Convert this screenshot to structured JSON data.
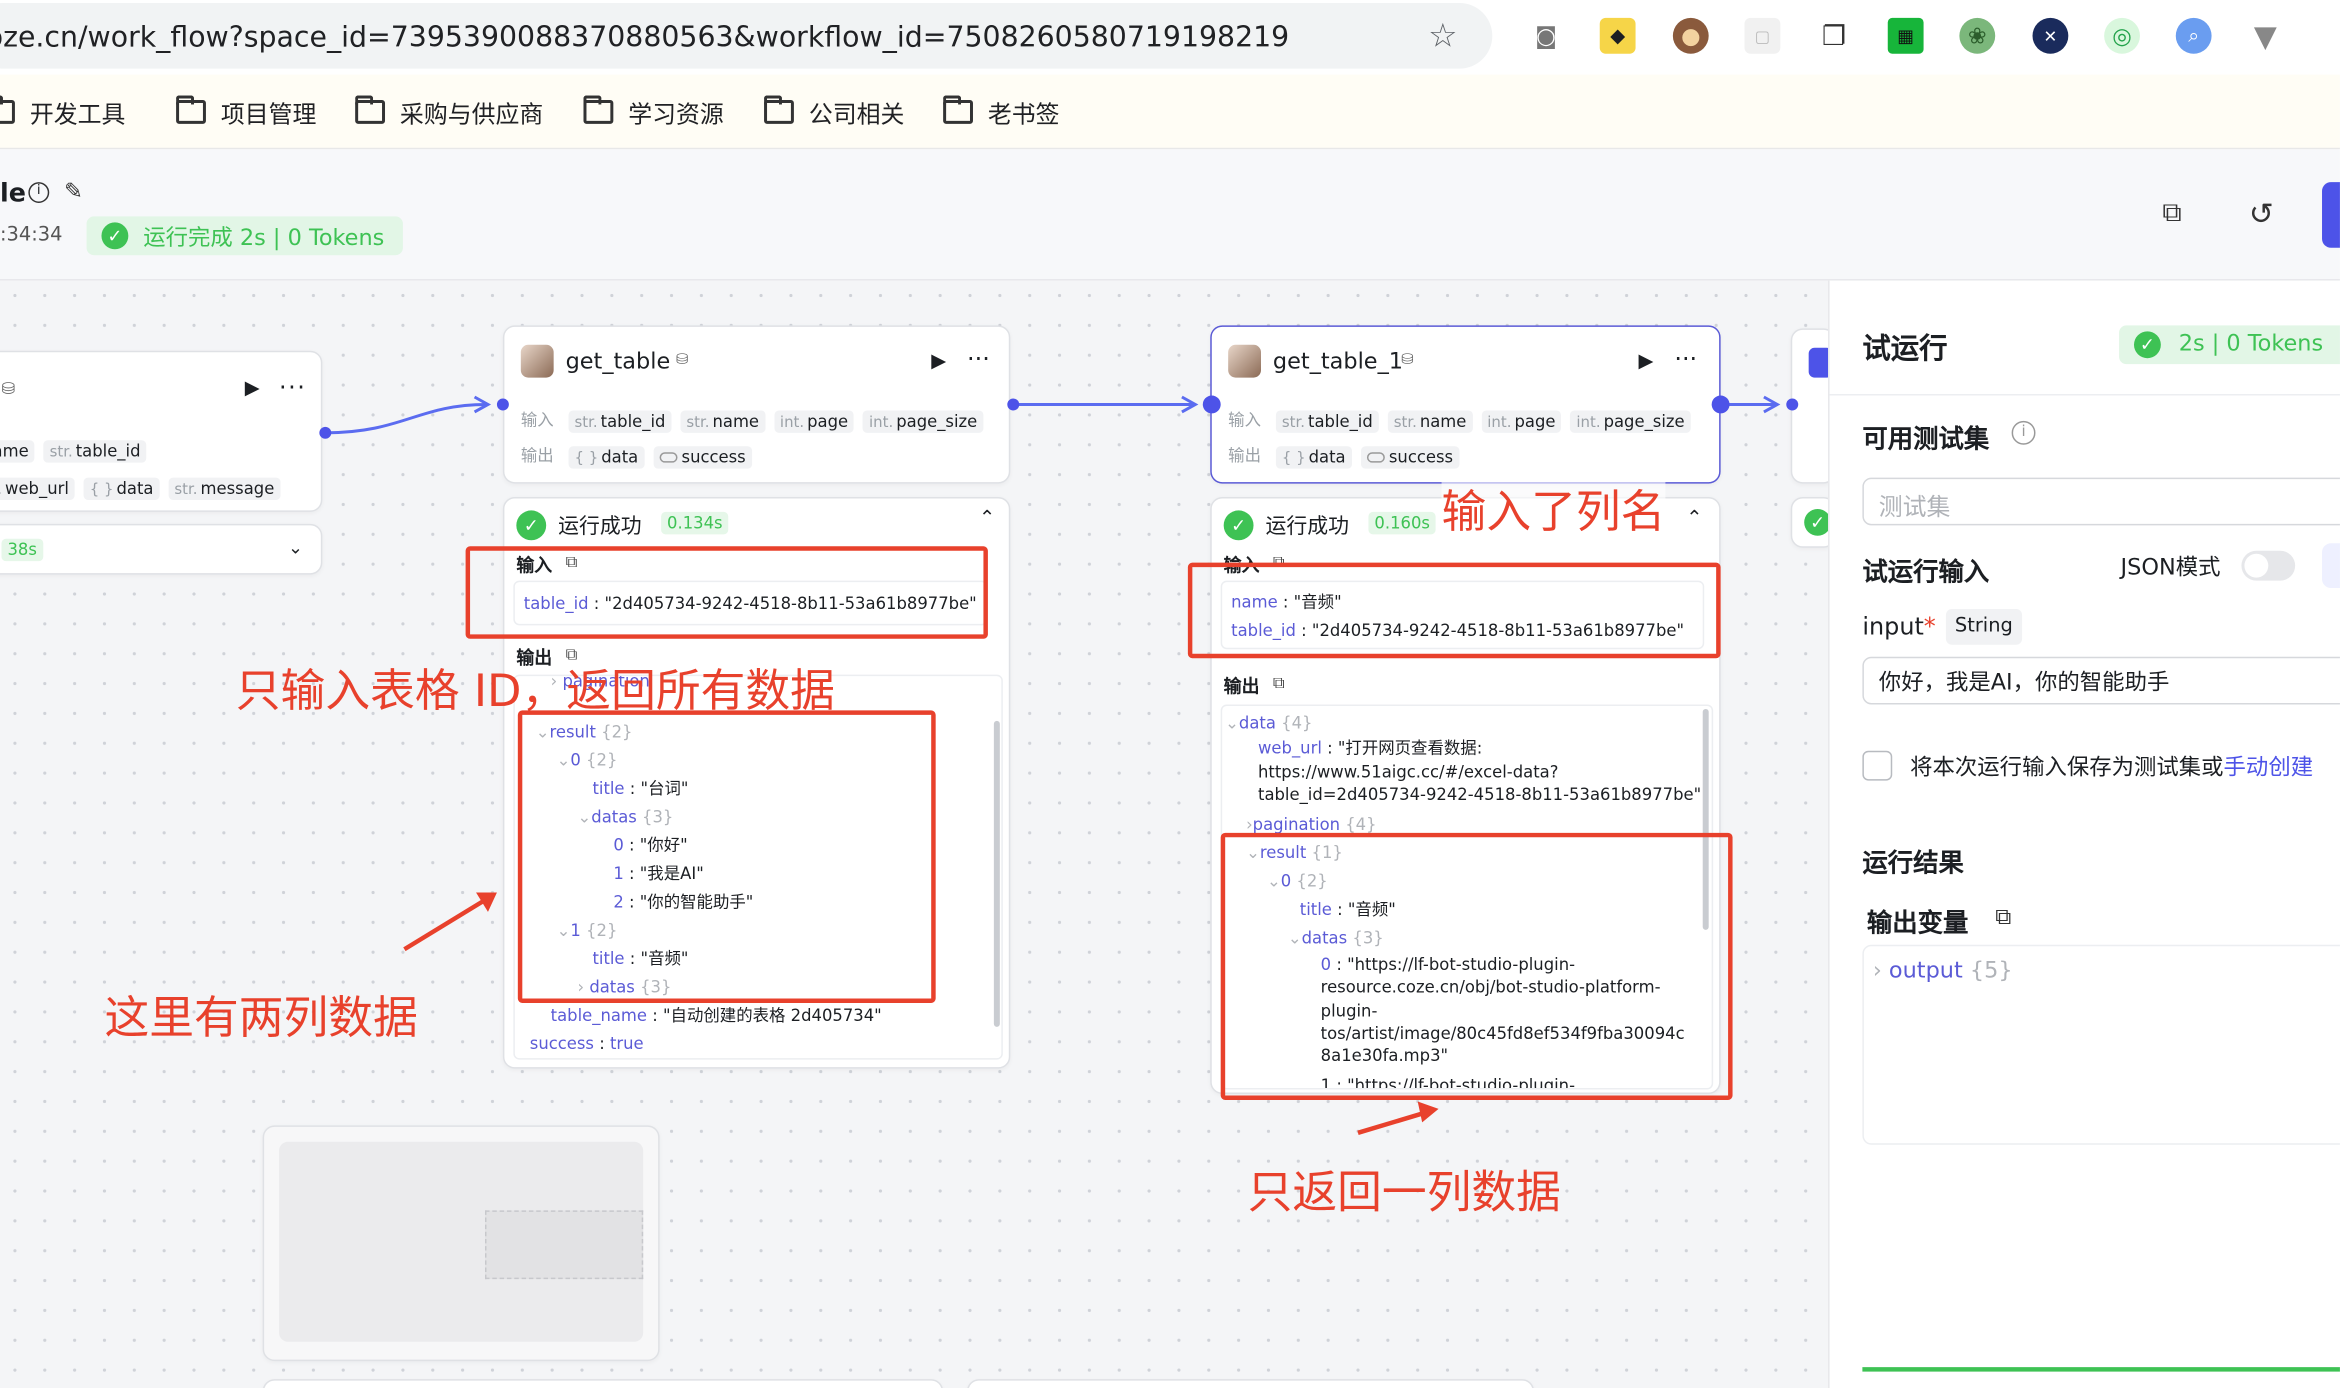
{
  "browser": {
    "url": "coze.cn/work_flow?space_id=7395390088370880563&workflow_id=7508260580719198219",
    "bookmarks": [
      "开发工具",
      "项目管理",
      "采购与供应商",
      "学习资源",
      "公司相关",
      "老书签"
    ]
  },
  "header": {
    "title_fragment": "le",
    "time_fragment": ":34:34",
    "status": "运行完成 2s | 0 Tokens"
  },
  "node_left": {
    "chips_row1": [
      {
        "type": "",
        "name": "ame"
      },
      {
        "type": "str.",
        "name": "table_id"
      }
    ],
    "chips_row2": [
      {
        "type": "r.",
        "name": "web_url"
      },
      {
        "type": "{ }",
        "name": "data"
      },
      {
        "type": "str.",
        "name": "message"
      }
    ],
    "tag_fragment": "38s"
  },
  "node1": {
    "title": "get_table",
    "input_label": "输入",
    "output_label": "输出",
    "inputs": [
      {
        "type": "str.",
        "name": "table_id"
      },
      {
        "type": "str.",
        "name": "name"
      },
      {
        "type": "int.",
        "name": "page"
      },
      {
        "type": "int.",
        "name": "page_size"
      }
    ],
    "outputs": [
      {
        "type": "{ }",
        "name": "data"
      },
      {
        "type": "",
        "name": "success"
      }
    ],
    "result_status": "运行成功",
    "result_time": "0.134s",
    "result_input_header": "输入",
    "result_input_key": "table_id",
    "result_input_value": "\"2d405734-9242-4518-8b11-53a61b8977be\"",
    "result_output_header": "输出",
    "tree": {
      "pagination": "pagination",
      "result": "result",
      "result_count": "{2}",
      "i0": "0",
      "i0_count": "{2}",
      "title_key": "title",
      "title0": "\"台词\"",
      "datas_key": "datas",
      "datas0_count": "{3}",
      "d0k": "0",
      "d0": "\"你好\"",
      "d1k": "1",
      "d1": "\"我是AI\"",
      "d2k": "2",
      "d2": "\"你的智能助手\"",
      "i1": "1",
      "i1_count": "{2}",
      "title1": "\"音频\"",
      "datas1_count": "{3}",
      "table_name_key": "table_name",
      "table_name": "\"自动创建的表格 2d405734\"",
      "success_key": "success",
      "success": "true"
    }
  },
  "node2": {
    "title": "get_table_1",
    "input_label": "输入",
    "output_label": "输出",
    "inputs": [
      {
        "type": "str.",
        "name": "table_id"
      },
      {
        "type": "str.",
        "name": "name"
      },
      {
        "type": "int.",
        "name": "page"
      },
      {
        "type": "int.",
        "name": "page_size"
      }
    ],
    "outputs": [
      {
        "type": "{ }",
        "name": "data"
      },
      {
        "type": "",
        "name": "success"
      }
    ],
    "result_status": "运行成功",
    "result_time": "0.160s",
    "result_input_header": "输入",
    "name_key": "name",
    "name_value": "\"音频\"",
    "table_id_key": "table_id",
    "table_id_value": "\"2d405734-9242-4518-8b11-53a61b8977be\"",
    "result_output_header": "输出",
    "tree": {
      "data": "data",
      "data_count": "{4}",
      "web_url_key": "web_url",
      "web_url_l1": "\"打开网页查看数据:",
      "web_url_l2": "https://www.51aigc.cc/#/excel-data?",
      "web_url_l3": "table_id=2d405734-9242-4518-8b11-53a61b8977be\"",
      "pagination": "pagination",
      "pagination_count": "{4}",
      "result": "result",
      "result_count": "{1}",
      "i0": "0",
      "i0_count": "{2}",
      "title_key": "title",
      "title": "\"音频\"",
      "datas_key": "datas",
      "datas_count": "{3}",
      "d0k": "0",
      "d0_l1": "\"https://lf-bot-studio-plugin-",
      "d0_l2": "resource.coze.cn/obj/bot-studio-platform-",
      "d0_l3": "plugin-",
      "d0_l4": "tos/artist/image/80c45fd8ef534f9fba30094c",
      "d0_l5": "8a1e30fa.mp3\"",
      "d1_l1": "1 : \"https://lf-bot-studio-plugin-"
    }
  },
  "annotations": {
    "a1": "只输入表格 ID，返回所有数据",
    "a2": "这里有两列数据",
    "a3": "输入了列名",
    "a4": "只返回一列数据"
  },
  "panel": {
    "title": "试运行",
    "status": "2s | 0 Tokens",
    "testset_label": "可用测试集",
    "testset_placeholder": "测试集",
    "run_input_label": "试运行输入",
    "json_mode": "JSON模式",
    "input_name": "input",
    "input_type": "String",
    "input_value": "你好，我是AI，你的智能助手",
    "save_text": "将本次运行输入保存为测试集或",
    "save_link": "手动创建",
    "result_label": "运行结果",
    "output_var_label": "输出变量",
    "output_key": "output",
    "output_count": "{5}"
  }
}
